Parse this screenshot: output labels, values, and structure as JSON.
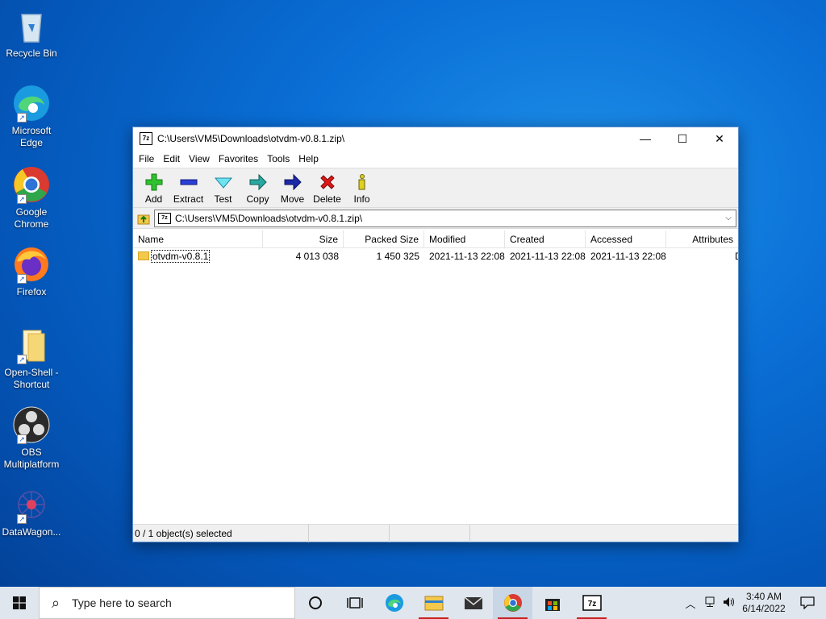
{
  "desktop": {
    "icons": [
      {
        "label": "Recycle Bin"
      },
      {
        "label": "Microsoft Edge"
      },
      {
        "label": "Google Chrome"
      },
      {
        "label": "Firefox"
      },
      {
        "label": "Open-Shell - Shortcut"
      },
      {
        "label": "OBS Multiplatform"
      },
      {
        "label": "DataWagon..."
      }
    ]
  },
  "window": {
    "title": "C:\\Users\\VM5\\Downloads\\otvdm-v0.8.1.zip\\",
    "app_icon_text": "7z",
    "controls": {
      "minimize": "—",
      "maximize": "☐",
      "close": "✕"
    },
    "menu": [
      "File",
      "Edit",
      "View",
      "Favorites",
      "Tools",
      "Help"
    ],
    "toolbar": [
      {
        "label": "Add",
        "icon": "plus-icon"
      },
      {
        "label": "Extract",
        "icon": "minus-icon"
      },
      {
        "label": "Test",
        "icon": "check-icon"
      },
      {
        "label": "Copy",
        "icon": "copy-arrow-icon"
      },
      {
        "label": "Move",
        "icon": "move-arrow-icon"
      },
      {
        "label": "Delete",
        "icon": "delete-x-icon"
      },
      {
        "label": "Info",
        "icon": "info-icon"
      }
    ],
    "address": {
      "path": "C:\\Users\\VM5\\Downloads\\otvdm-v0.8.1.zip\\"
    },
    "columns": [
      "Name",
      "Size",
      "Packed Size",
      "Modified",
      "Created",
      "Accessed",
      "Attributes"
    ],
    "rows": [
      {
        "name": "otvdm-v0.8.1",
        "size": "4 013 038",
        "packed": "1 450 325",
        "modified": "2021-11-13 22:08",
        "created": "2021-11-13 22:08",
        "accessed": "2021-11-13 22:08",
        "attributes": "D"
      }
    ],
    "status": {
      "selection": "0 / 1 object(s) selected",
      "seg2": "",
      "seg3": "",
      "seg4": ""
    }
  },
  "taskbar": {
    "search_placeholder": "Type here to search",
    "clock": {
      "time": "3:40 AM",
      "date": "6/14/2022"
    },
    "apps": [
      "task-view",
      "edge",
      "file-explorer",
      "mail",
      "chrome",
      "store",
      "7zip"
    ]
  },
  "colors": {
    "accent": "#0a6fd6",
    "taskbar": "#dfe6ee",
    "running_indicator": "#c81e1e"
  }
}
